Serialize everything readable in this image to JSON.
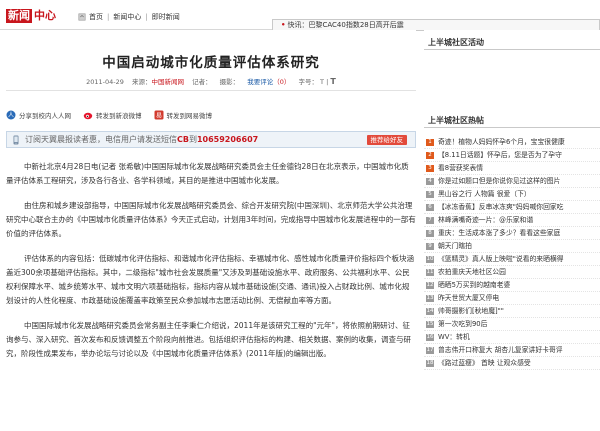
{
  "header": {
    "logo_part1": "新闻",
    "logo_part2": "中心",
    "breadcrumb": [
      {
        "label": "首页"
      },
      {
        "label": "新闻中心"
      },
      {
        "label": "即时新闻"
      }
    ],
    "ticker": "快讯：巴黎CAC40指数28日高开后震"
  },
  "article": {
    "title": "中国启动城市化质量评估体系研究",
    "meta": {
      "date": "2011-04-29",
      "source_label": "来源：",
      "source": "中国新闻网",
      "reporter_label": "记者：",
      "photographer_label": "摄影：",
      "comment_label": "我要评论",
      "comment_count": "（0）",
      "font_label": "字号：",
      "font_small": "T",
      "font_large": "T"
    },
    "share": [
      {
        "label": "分享到校内人人网",
        "icon": "renren-icon"
      },
      {
        "label": "转发到新浪微博",
        "icon": "sina-weibo-icon"
      },
      {
        "label": "转发到网易微博",
        "icon": "netease-weibo-icon"
      }
    ],
    "promo": {
      "text_pre": "订阅天翼晨报读者惠，电信用户请发送短信",
      "code": "CB",
      "text_mid": "到",
      "number": "10659206607",
      "button": "推荐给好友"
    },
    "paragraphs": [
      "中新社北京4月28日电(记者 张希敏)中国国际城市化发展战略研究委员会主任金德钧28日在北京表示，中国城市化质量评估体系工程研究，涉及各行各业、各学科领域，其目的是推进中国城市化发展。",
      "由住房和城乡建设部指导，中国国际城市化发展战略研究委员会、综合开发研究院(中国深圳)、北京师范大学公共治理研究中心联合主办的《中国城市化质量评估体系》今天正式启动，计划用3年时间，完成指导中国城市化发展进程中的一部有价值的评估体系。",
      "评估体系的内容包括：低碳城市化评估指标、和谐城市化评估指标、幸福城市化、感性城市化质量评价指标四个板块涵盖近300余项基础评估指标。其中，二级指标\"城市社会发展质量\"又涉及到基础设施水平、政府服务、公共福利水平、公民权利保障水平、城乡统筹水平、城市文明六项基础指标，指标内容从城市基础设施(交通、通讯)投入占财政比例、城市化规划设计的人性化程度、市政基础设施覆盖率政策至民众参加城市志愿活动比例、无偿献血率等方面。",
      "中国国际城市化发展战略研究委员会常务副主任李秉仁介绍说，2011年是该研究工程的\"元年\"，将依照前期研讨、征询参与、深入研究、首次发布和反馈调整五个阶段向前推进。包括组织评估指标的构建、相关数据、案例的收集，调查与研究，阶段性成果发布，举办论坛与讨论以及《中国城市化质量评估体系》(2011年版)的编辑出版。"
    ]
  },
  "sidebar": {
    "activity_title": "上半城社区活动",
    "hot_title": "上半城社区热帖",
    "hot_items": [
      {
        "num": "1",
        "text": "奇迹！植物人妈妈怀孕6个月，宝宝很健康"
      },
      {
        "num": "2",
        "text": "【8.11日话题】怀孕后，您是否为了孕守"
      },
      {
        "num": "3",
        "text": "看8营获奖表情"
      },
      {
        "num": "4",
        "text": "你是过如题口但是你说你见过这样的图片"
      },
      {
        "num": "5",
        "text": "黑山谷之行 人物篇 很爱（下）"
      },
      {
        "num": "6",
        "text": "【冰冻香蕉】反串冰冻爽\"妈妈喊你回家吃"
      },
      {
        "num": "7",
        "text": "林峰满嘴奇迹一片：@乐家和谐"
      },
      {
        "num": "8",
        "text": "重庆：生活成本涨了多少？看看这些家庭"
      },
      {
        "num": "9",
        "text": "朝天门瞎拍"
      },
      {
        "num": "10",
        "text": "《篮精灵》真人版上映啦\"说看的来晒横得"
      },
      {
        "num": "11",
        "text": "农拍重庆天地社区公园"
      },
      {
        "num": "12",
        "text": "晒晒5万买到的越南老婆"
      },
      {
        "num": "13",
        "text": "昨天世贸大厦又停电"
      },
      {
        "num": "14",
        "text": "帅哥摄影们[秋地魔]\"\""
      },
      {
        "num": "15",
        "text": "第一次吃到90后"
      },
      {
        "num": "16",
        "text": "WV：转机"
      },
      {
        "num": "17",
        "text": "曾志伟开口称复大 胡杏儿复家讲好卡哥评"
      },
      {
        "num": "18",
        "text": "《路过蓝瘦》 首映 让观众感受"
      }
    ]
  }
}
